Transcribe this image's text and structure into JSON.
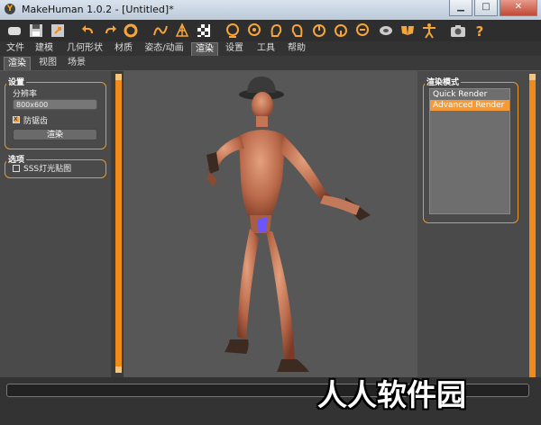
{
  "window": {
    "title": "MakeHuman 1.0.2 - [Untitled]*",
    "app_icon": "makehuman-logo-icon",
    "controls": [
      "minimize",
      "maximize",
      "close"
    ]
  },
  "toolbar": {
    "icons": [
      "new-file-icon",
      "save-icon",
      "export-icon",
      "undo-icon",
      "redo-icon",
      "reset-icon",
      "smooth-icon",
      "wireframe-icon",
      "background-icon",
      "front-view-icon",
      "back-view-icon",
      "left-view-icon",
      "right-view-icon",
      "top-view-icon",
      "bottom-view-icon",
      "reset-camera-icon",
      "pose-icon",
      "symmetry-icon",
      "screenshot-icon",
      "help-icon"
    ]
  },
  "menus": [
    "文件",
    "建模",
    "几何形状",
    "材质",
    "姿态/动画",
    "渲染",
    "设置",
    "工具",
    "帮助"
  ],
  "active_menu": "渲染",
  "subtabs": [
    "渲染",
    "视图",
    "场景"
  ],
  "active_subtab": "渲染",
  "settings": {
    "title": "设置",
    "resolution_label": "分辨率",
    "resolution_value": "800x600",
    "antialias_label": "防锯齿",
    "antialias_checked": true,
    "render_button": "渲染"
  },
  "options": {
    "title": "选项",
    "sss_label": "SSS灯光贴图",
    "sss_checked": false
  },
  "render_mode": {
    "title": "渲染模式",
    "items": [
      "Quick Render",
      "Advanced Render"
    ],
    "selected": "Advanced Render"
  },
  "watermark": "人人软件园",
  "colors": {
    "accent": "#f08b1a",
    "selection": "#f59a34",
    "panel": "#4a4a4a",
    "viewport": "#575757"
  }
}
